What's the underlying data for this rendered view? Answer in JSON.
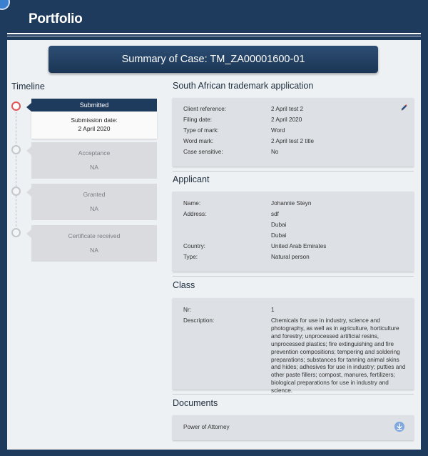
{
  "header": {
    "title": "Portfolio"
  },
  "summary": {
    "title": "Summary of Case: TM_ZA00001600-01"
  },
  "timeline": {
    "heading": "Timeline",
    "steps": [
      {
        "title": "Submitted",
        "detail_label": "Submission date:",
        "detail_value": "2 April 2020"
      },
      {
        "title": "Acceptance",
        "value": "NA"
      },
      {
        "title": "Granted",
        "value": "NA"
      },
      {
        "title": "Certificate received",
        "value": "NA"
      }
    ]
  },
  "application": {
    "heading": "South African trademark application",
    "rows": [
      {
        "label": "Client reference:",
        "value": "2 April test 2"
      },
      {
        "label": "Filing date:",
        "value": "2 April 2020"
      },
      {
        "label": "Type of mark:",
        "value": "Word"
      },
      {
        "label": "Word mark:",
        "value": "2 April test 2 title"
      },
      {
        "label": "Case sensitive:",
        "value": "No"
      }
    ]
  },
  "applicant": {
    "heading": "Applicant",
    "name_label": "Name:",
    "name": "Johannie Steyn",
    "address_label": "Address:",
    "address_lines": [
      "sdf",
      "Dubai",
      "Dubai"
    ],
    "country_label": "Country:",
    "country": "United Arab Emirates",
    "type_label": "Type:",
    "type": "Natural person"
  },
  "class_section": {
    "heading": "Class",
    "nr_label": "Nr:",
    "nr": "1",
    "description_label": "Description:",
    "description": "Chemicals for use in industry, science and photography, as well as in agriculture, horticulture and forestry; unprocessed artificial resins, unprocessed plastics; fire extinguishing and fire prevention compositions; tempering and soldering preparations; substances for tanning animal skins and hides; adhesives for use in industry; putties and other paste fillers; compost, manures, fertilizers; biological preparations for use in industry and science."
  },
  "documents": {
    "heading": "Documents",
    "items": [
      {
        "name": "Power of Attorney"
      }
    ]
  },
  "colors": {
    "navy": "#1e3a5c",
    "accent_red": "#e05555",
    "download_blue": "#7fa8df"
  },
  "icons": {
    "edit": "pencil-icon",
    "download": "download-icon"
  }
}
